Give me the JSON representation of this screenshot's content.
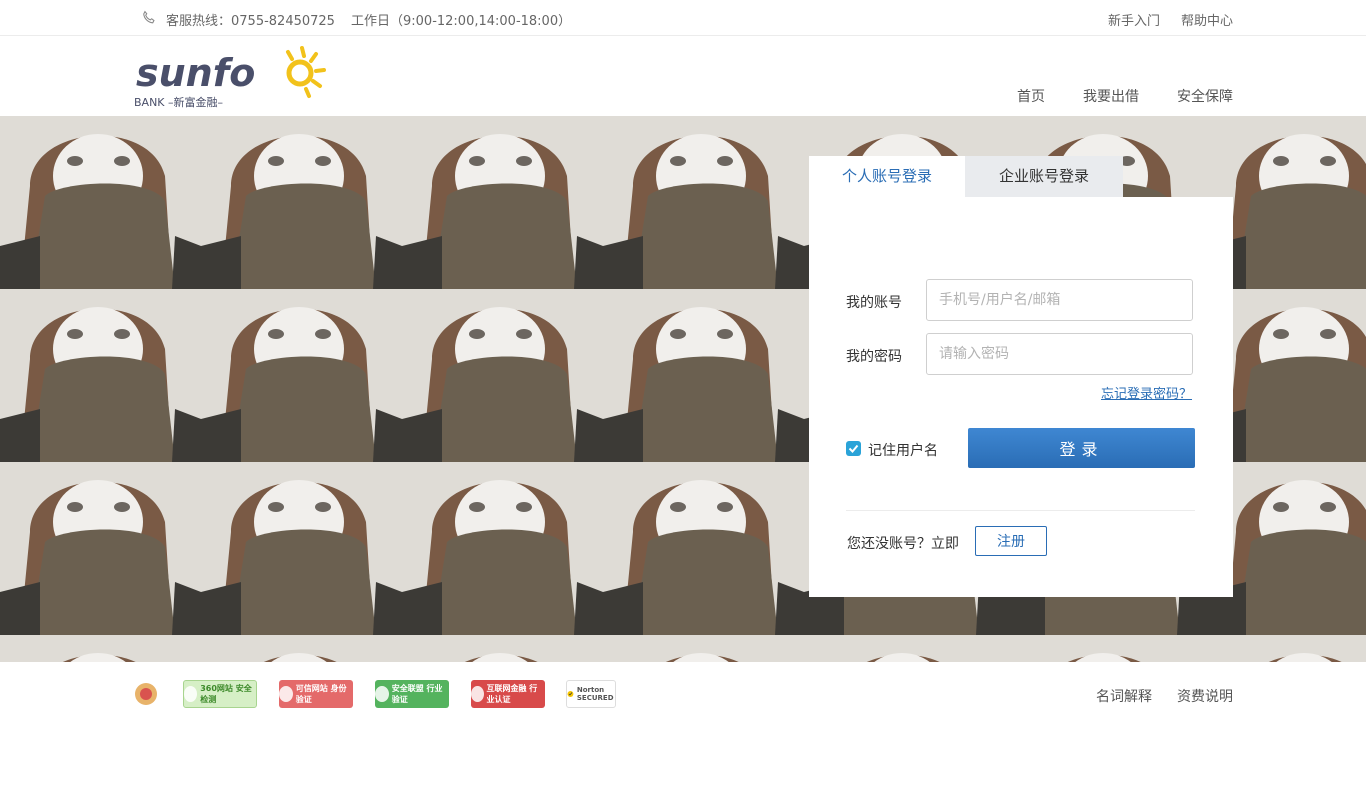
{
  "topbar": {
    "hotline": "客服热线：0755-82450725",
    "hours": "工作日（9:00-12:00,14:00-18:00）",
    "guide": "新手入门",
    "help": "帮助中心"
  },
  "header": {
    "logo_text": "sunfo",
    "logo_sub": "BANK –新富金融–",
    "nav": [
      "首页",
      "我要出借",
      "安全保障"
    ]
  },
  "login": {
    "tabs": [
      "个人账号登录",
      "企业账号登录"
    ],
    "active_tab": 0,
    "account_label": "我的账号",
    "account_placeholder": "手机号/用户名/邮箱",
    "password_label": "我的密码",
    "password_placeholder": "请输入密码",
    "forgot": "忘记登录密码？",
    "remember": "记住用户名",
    "remember_checked": true,
    "submit": "登录",
    "no_account": "您还没账号？立即",
    "register": "注册"
  },
  "footer": {
    "badges": [
      {
        "icon": "police-badge-icon",
        "text": ""
      },
      {
        "icon": "360-security-icon",
        "text": "360网站 安全检测"
      },
      {
        "icon": "kexin-icon",
        "text": "可信网站 身份验证"
      },
      {
        "icon": "anquan-icon",
        "text": "安全联盟 行业验证"
      },
      {
        "icon": "hulian-icon",
        "text": "互联网金融 行业认证"
      },
      {
        "icon": "norton-icon",
        "text": "Norton SECURED"
      }
    ],
    "links": [
      "名词解释",
      "资费说明"
    ]
  },
  "colors": {
    "accent": "#2a6db5",
    "checkbox": "#2aa3d8",
    "logo_sun": "#f2c21b",
    "logo_text": "#4a4f6a"
  }
}
